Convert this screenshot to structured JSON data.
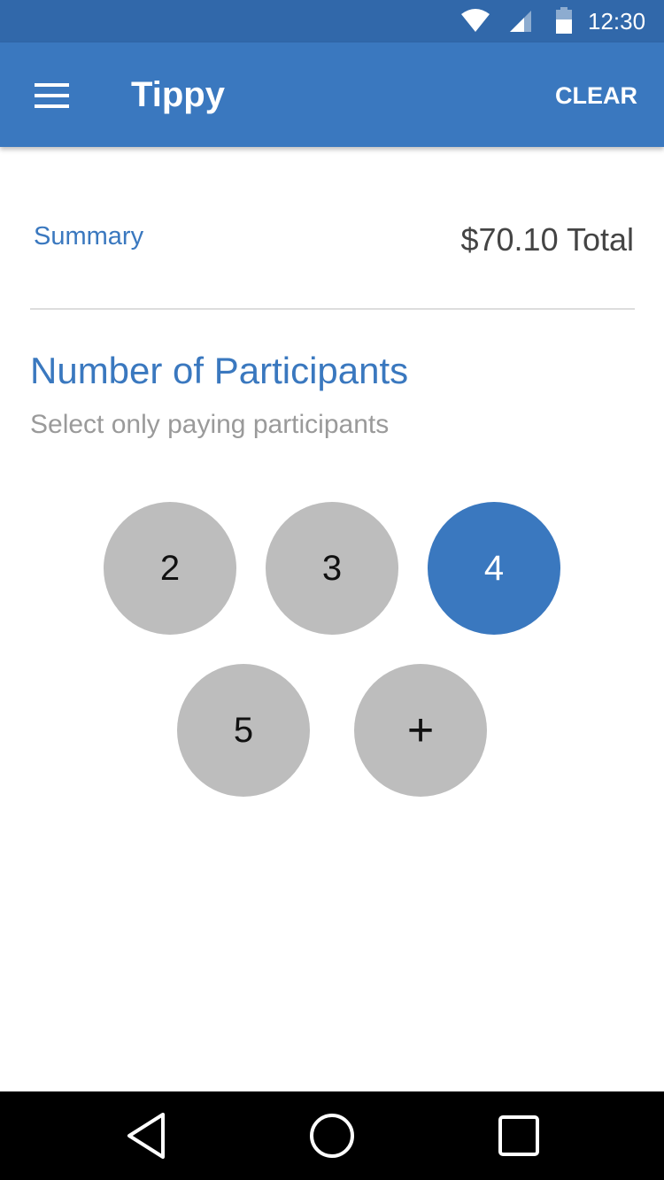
{
  "status_bar": {
    "time": "12:30",
    "icons": [
      "wifi-icon",
      "cell-signal-icon",
      "battery-icon"
    ],
    "background": "#3168AA"
  },
  "app_bar": {
    "title": "Tippy",
    "menu_icon": "hamburger-menu-icon",
    "action_label": "CLEAR",
    "background": "#3A78BF"
  },
  "summary": {
    "label": "Summary",
    "total": "$70.10 Total"
  },
  "participants": {
    "title": "Number of Participants",
    "subtitle": "Select only paying participants",
    "options": [
      "2",
      "3",
      "4",
      "5",
      "+"
    ],
    "selected": "4",
    "selected_color": "#3A78BF",
    "option_color": "#BDBDBD"
  },
  "nav_bar": {
    "icons": [
      "back-triangle-icon",
      "home-circle-icon",
      "recents-square-icon"
    ]
  }
}
